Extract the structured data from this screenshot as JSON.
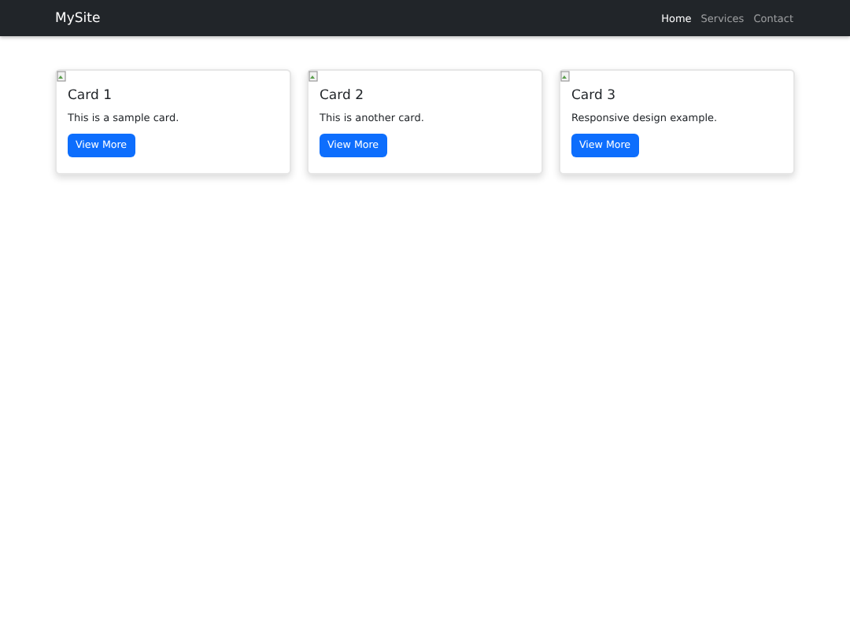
{
  "navbar": {
    "brand": "MySite",
    "links": [
      {
        "label": "Home",
        "selected": true
      },
      {
        "label": "Services",
        "selected": false
      },
      {
        "label": "Contact",
        "selected": false
      }
    ]
  },
  "cards": [
    {
      "title": "Card 1",
      "text": "This is a sample card.",
      "button": "View More"
    },
    {
      "title": "Card 2",
      "text": "This is another card.",
      "button": "View More"
    },
    {
      "title": "Card 3",
      "text": "Responsive design example.",
      "button": "View More"
    }
  ]
}
